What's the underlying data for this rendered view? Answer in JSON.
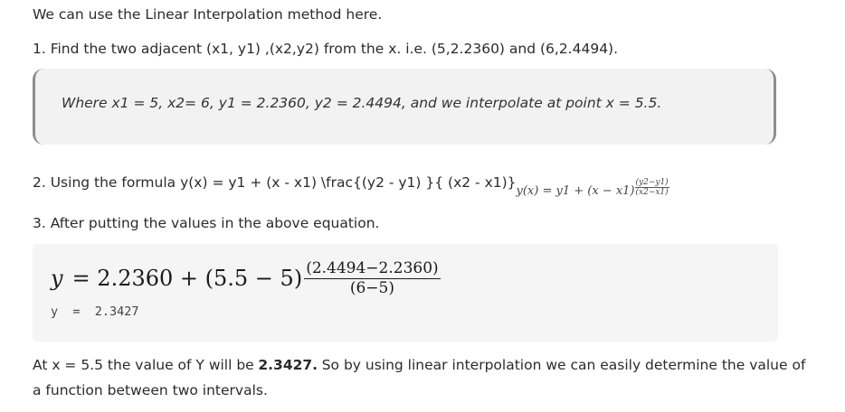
{
  "intro": "We can use the Linear Interpolation method here.",
  "step1": {
    "text": "1. Find the two adjacent  (x1, y1) ,(x2,y2) from the x. i.e. (5,2.2360) and (6,2.4494)."
  },
  "note": "Where x1 = 5, x2= 6, y1 = 2.2360, y2 = 2.4494, and we interpolate at point x = 5.5.",
  "step2": {
    "text": "2. Using the formula y(x)  =  y1  +  (x - x1)  \\frac{(y2 - y1) }{ (x2 - x1)}",
    "rendered_lhs": "y(x) = y1 + (x − x1)",
    "rendered_num": "(y2−y1)",
    "rendered_den": "(x2−x1)"
  },
  "step3": "3. After putting the values in the above equation.",
  "equation": {
    "lhs": "y",
    "rhs": "= 2.2360 + (5.5 − 5)",
    "numerator": "(2.4494−2.2360)",
    "denominator": "(6−5)"
  },
  "code_result": "y  =  2.3427",
  "conclusion": {
    "prefix": "At x = 5.5 the value of Y will be",
    "value": "2.3427.",
    "suffix": "So by using linear interpolation we can easily determine the value of",
    "line2": "a function between two intervals."
  }
}
